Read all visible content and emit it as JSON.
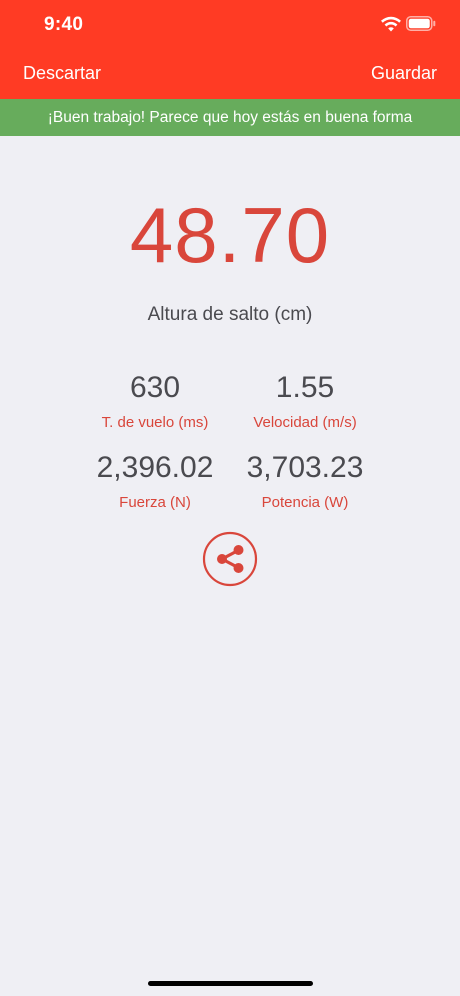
{
  "status_bar": {
    "time": "9:40"
  },
  "nav": {
    "discard_label": "Descartar",
    "save_label": "Guardar"
  },
  "banner": {
    "message": "¡Buen trabajo! Parece que hoy estás en buena forma"
  },
  "result": {
    "value": "48.70",
    "label": "Altura de salto (cm)"
  },
  "stats": [
    {
      "value": "630",
      "label": "T. de vuelo (ms)"
    },
    {
      "value": "1.55",
      "label": "Velocidad (m/s)"
    },
    {
      "value": "2,396.02",
      "label": "Fuerza (N)"
    },
    {
      "value": "3,703.23",
      "label": "Potencia (W)"
    }
  ],
  "icons": {
    "share": "share-icon",
    "wifi": "wifi-icon",
    "battery": "battery-icon"
  },
  "colors": {
    "header": "#ff3b24",
    "banner": "#67ac5c",
    "accent": "#d9463b",
    "background": "#efeff4",
    "text": "#4a4a4f"
  }
}
